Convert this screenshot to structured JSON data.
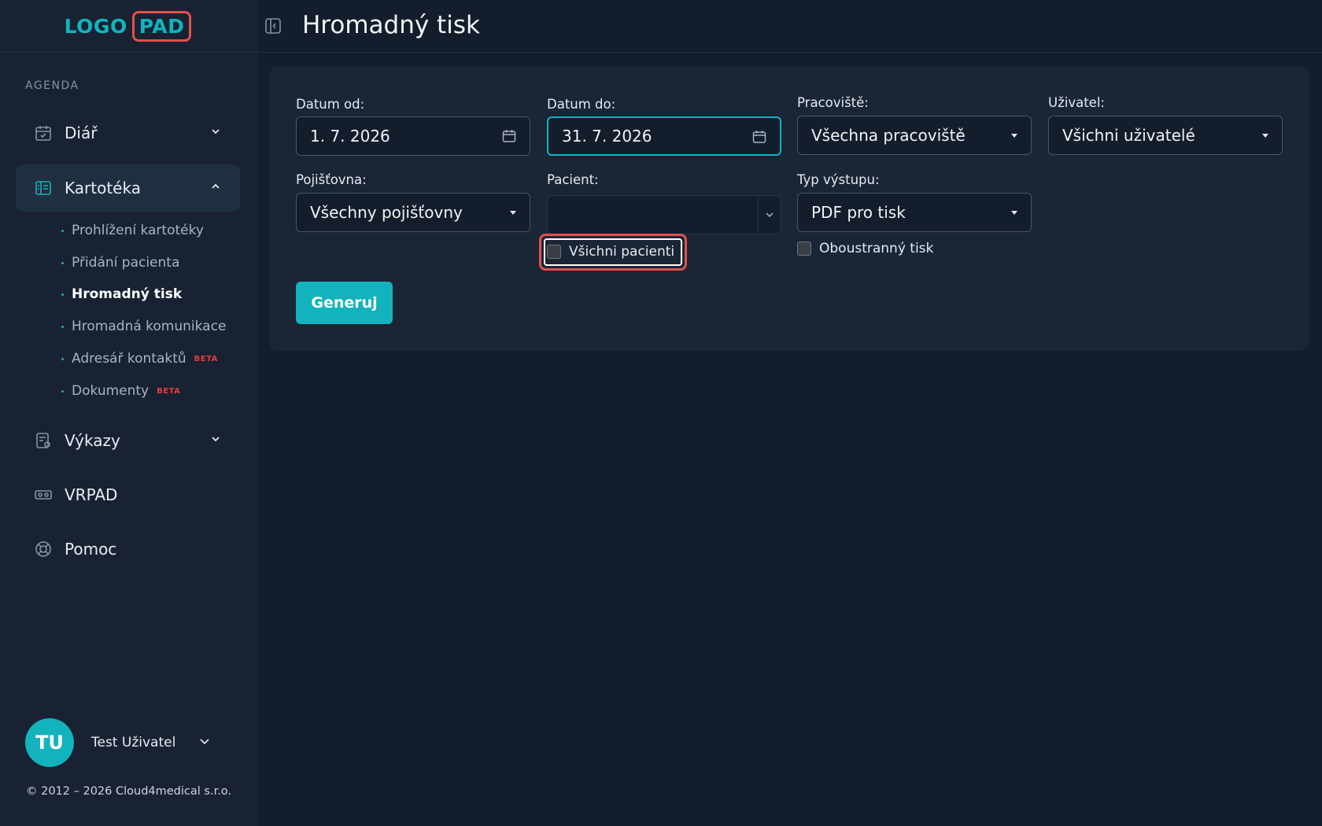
{
  "logo": {
    "part1": "LOGO",
    "part2": "PAD"
  },
  "sidebar": {
    "section_label": "AGENDA",
    "items": [
      {
        "label": "Diář",
        "icon": "calendar-check-icon"
      },
      {
        "label": "Kartotéka",
        "icon": "card-file-icon"
      },
      {
        "label": "Výkazy",
        "icon": "report-icon"
      },
      {
        "label": "VRPAD",
        "icon": "vr-headset-icon"
      },
      {
        "label": "Pomoc",
        "icon": "lifebuoy-icon"
      }
    ],
    "subitems": [
      {
        "label": "Prohlížení kartotéky"
      },
      {
        "label": "Přidání pacienta"
      },
      {
        "label": "Hromadný tisk"
      },
      {
        "label": "Hromadná komunikace"
      },
      {
        "label": "Adresář kontaktů",
        "badge": "BETA"
      },
      {
        "label": "Dokumenty",
        "badge": "BETA"
      }
    ],
    "user": {
      "initials": "TU",
      "name": "Test Uživatel"
    },
    "copyright": "© 2012 – 2026 Cloud4medical s.r.o."
  },
  "header": {
    "title": "Hromadný tisk"
  },
  "form": {
    "date_from": {
      "label": "Datum od:",
      "value": "1. 7. 2026"
    },
    "date_to": {
      "label": "Datum do:",
      "value": "31. 7. 2026"
    },
    "workplace": {
      "label": "Pracoviště:",
      "value": "Všechna pracoviště"
    },
    "user": {
      "label": "Uživatel:",
      "value": "Všichni uživatelé"
    },
    "insurance": {
      "label": "Pojišťovna:",
      "value": "Všechny pojišťovny"
    },
    "patient": {
      "label": "Pacient:",
      "value": ""
    },
    "output_type": {
      "label": "Typ výstupu:",
      "value": "PDF pro tisk"
    },
    "all_patients": {
      "label": "Všichni pacienti",
      "checked": false
    },
    "duplex": {
      "label": "Oboustranný tisk",
      "checked": false
    },
    "generate_label": "Generuj"
  },
  "colors": {
    "accent": "#13b3bd",
    "highlight": "#e0524b",
    "beta": "#e63b3b"
  }
}
